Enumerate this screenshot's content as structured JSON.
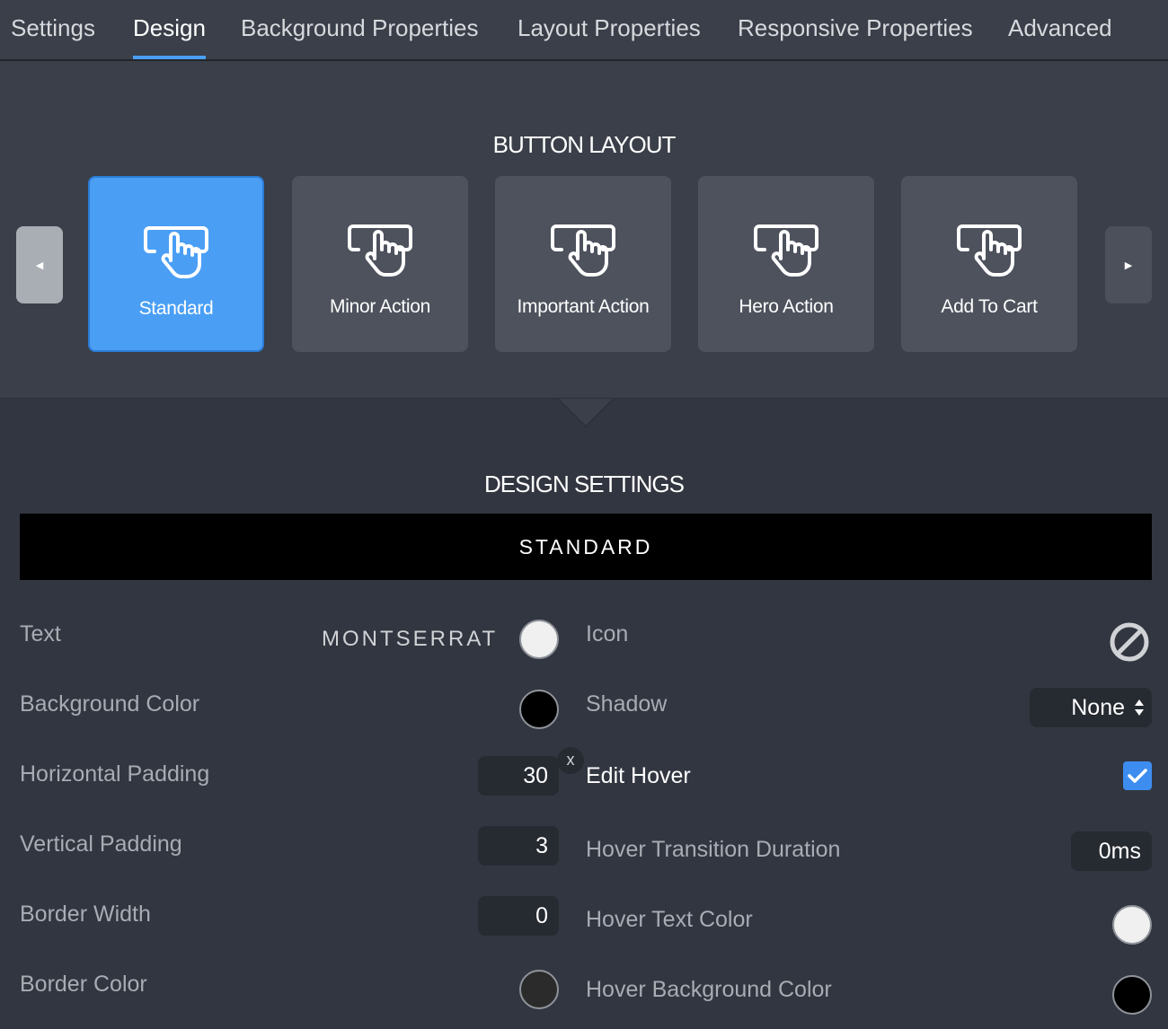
{
  "tabs": [
    {
      "label": "Settings"
    },
    {
      "label": "Design"
    },
    {
      "label": "Background Properties"
    },
    {
      "label": "Layout Properties"
    },
    {
      "label": "Responsive Properties"
    },
    {
      "label": "Advanced"
    }
  ],
  "active_tab": "Design",
  "layout": {
    "title": "BUTTON LAYOUT",
    "prev_icon": "triangle-left-icon",
    "next_icon": "triangle-right-icon",
    "cards": [
      {
        "label": "Standard",
        "icon": "pointer-hand-icon",
        "selected": true
      },
      {
        "label": "Minor Action",
        "icon": "pointer-hand-icon"
      },
      {
        "label": "Important Action",
        "icon": "pointer-hand-icon"
      },
      {
        "label": "Hero Action",
        "icon": "pointer-hand-icon"
      },
      {
        "label": "Add To Cart",
        "icon": "pointer-hand-icon"
      }
    ]
  },
  "design": {
    "title": "DESIGN SETTINGS",
    "preview_label": "STANDARD",
    "left": {
      "text_label": "Text",
      "font_name": "MONTSERRAT",
      "text_color": "#f0f0f0",
      "bg_color_label": "Background Color",
      "bg_color": "#000000",
      "h_padding_label": "Horizontal Padding",
      "h_padding": "30",
      "clear_label": "x",
      "v_padding_label": "Vertical Padding",
      "v_padding": "3",
      "border_width_label": "Border Width",
      "border_width": "0",
      "border_color_label": "Border Color",
      "border_color": "#2b2b2b"
    },
    "right": {
      "icon_label": "Icon",
      "icon_value": "no-icon",
      "shadow_label": "Shadow",
      "shadow_value": "None",
      "edit_hover_label": "Edit Hover",
      "edit_hover_checked": true,
      "hover_duration_label": "Hover Transition Duration",
      "hover_duration": "0ms",
      "hover_text_color_label": "Hover Text Color",
      "hover_text_color": "#f0f0f0",
      "hover_bg_color_label": "Hover Background Color",
      "hover_bg_color": "#000000"
    }
  },
  "colors": {
    "accent": "#4a9ff5",
    "panel": "#3a3f49",
    "card": "#4d525d",
    "background": "#323640"
  }
}
